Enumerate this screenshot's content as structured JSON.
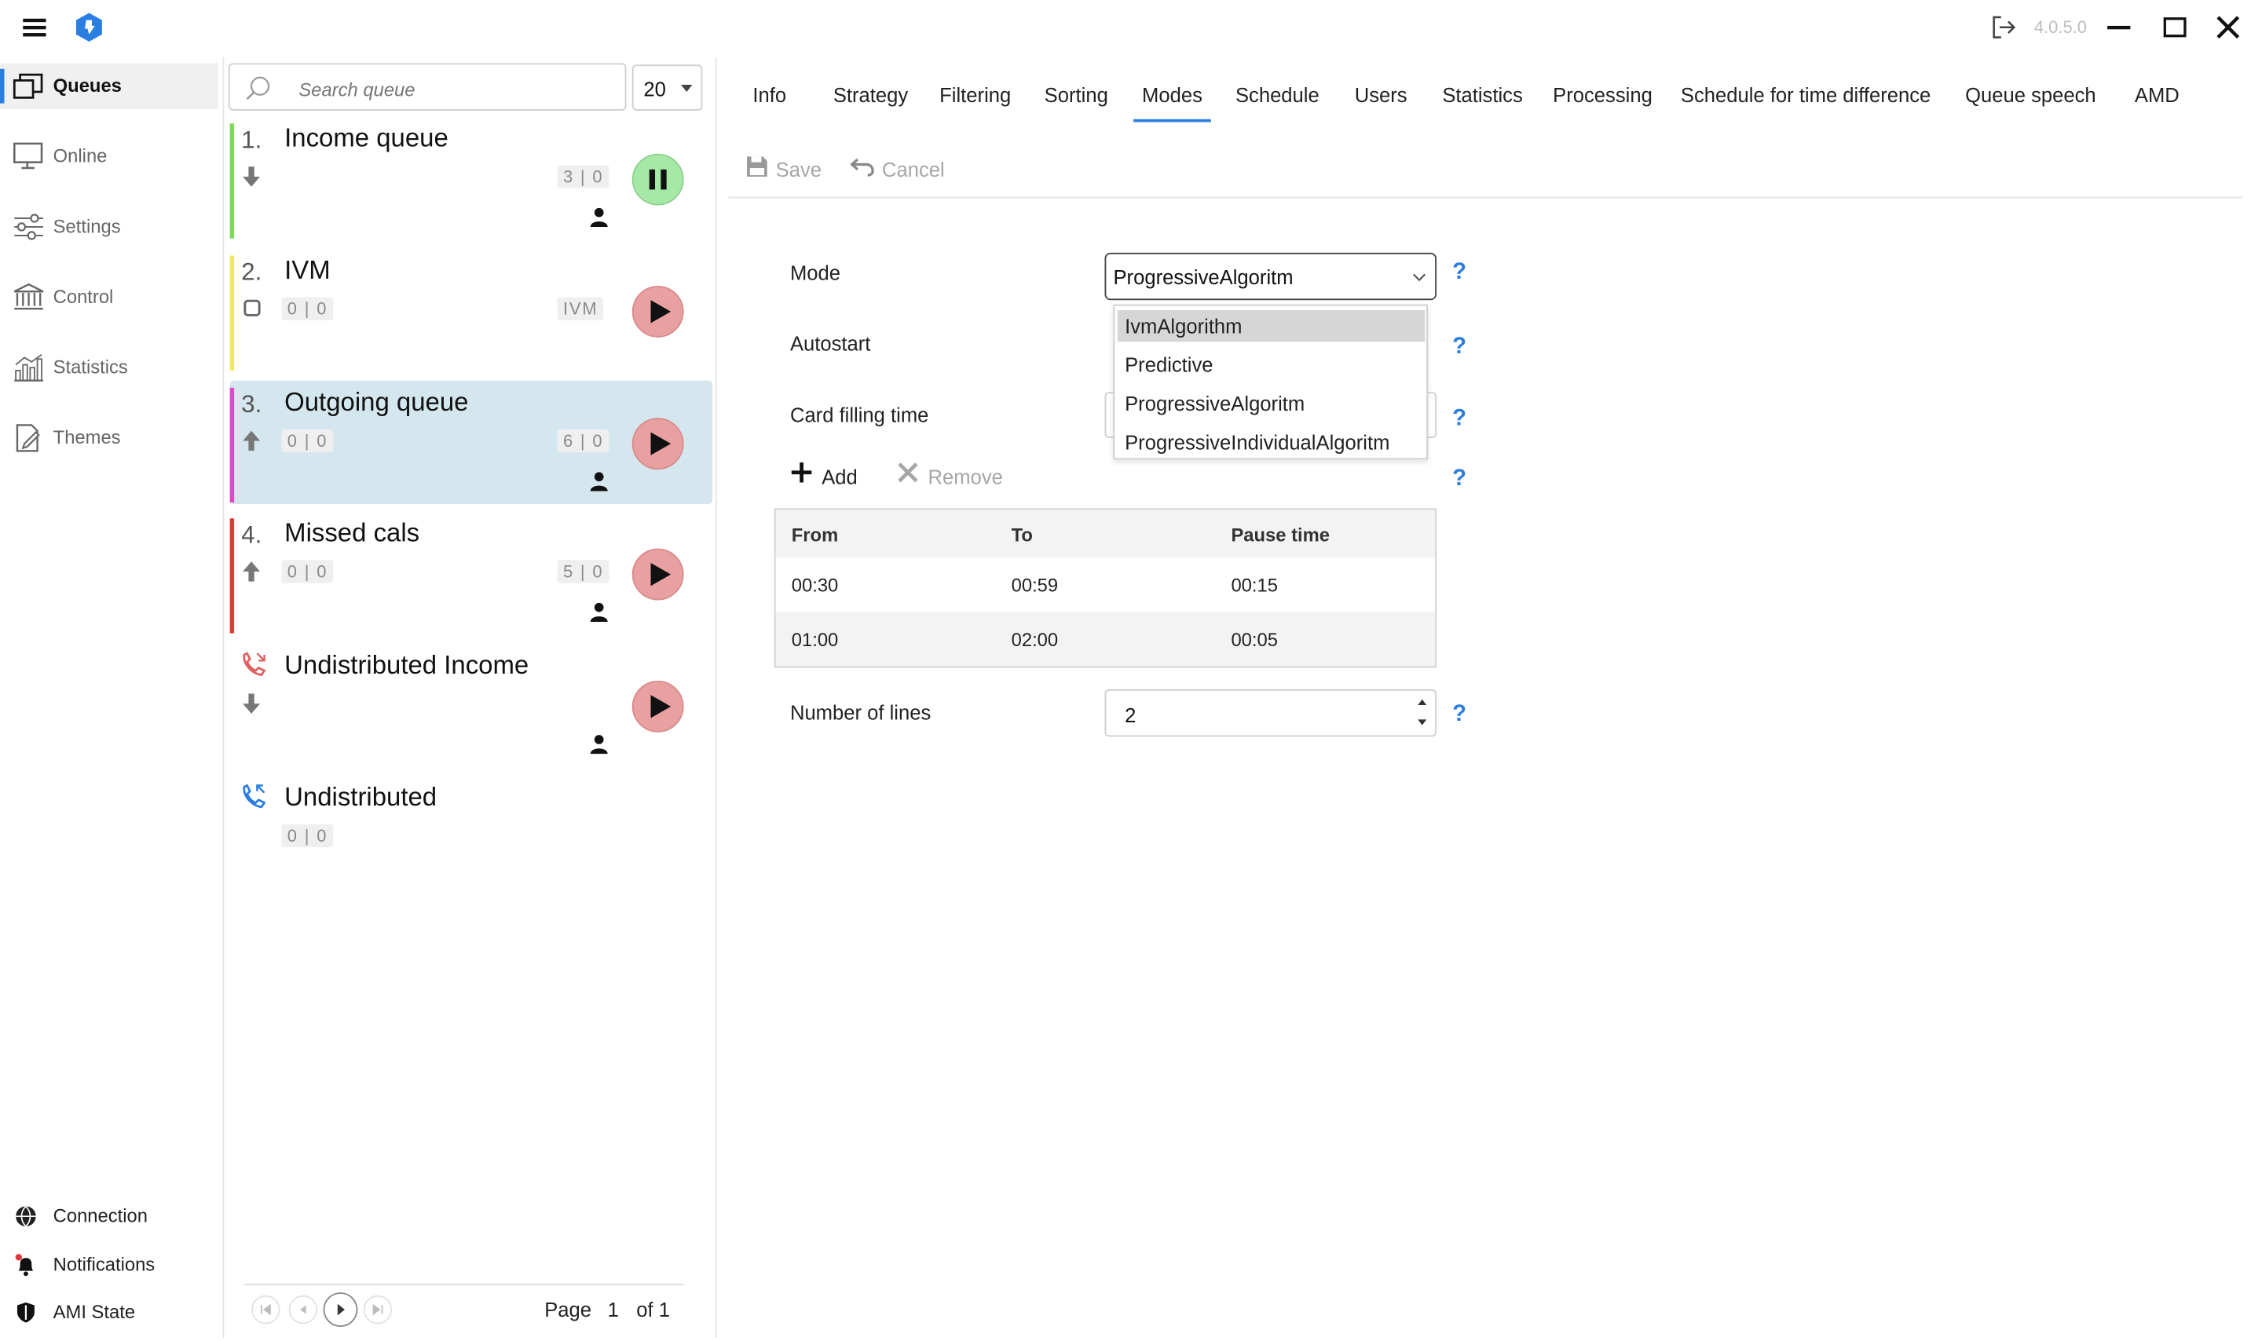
{
  "app": {
    "version": "4.0.5.0"
  },
  "nav": {
    "items": [
      {
        "label": "Queues",
        "active": true
      },
      {
        "label": "Online"
      },
      {
        "label": "Settings"
      },
      {
        "label": "Control"
      },
      {
        "label": "Statistics"
      },
      {
        "label": "Themes"
      }
    ],
    "bottom": [
      {
        "label": "Connection"
      },
      {
        "label": "Notifications"
      },
      {
        "label": "AMI State"
      }
    ]
  },
  "queue_panel": {
    "search_placeholder": "Search queue",
    "page_size": "20",
    "queues": [
      {
        "num": "1.",
        "title": "Income queue",
        "left_count": "",
        "right_count": "3 | 0",
        "bar_color": "#7ed957",
        "state": "pause"
      },
      {
        "num": "2.",
        "title": "IVM",
        "left_count": "0 | 0",
        "right_count": "IVM",
        "bar_color": "#f0ea5a",
        "state": "play"
      },
      {
        "num": "3.",
        "title": "Outgoing queue",
        "left_count": "0 | 0",
        "right_count": "6 | 0",
        "bar_color": "#e048c8",
        "state": "play",
        "selected": true
      },
      {
        "num": "4.",
        "title": "Missed cals",
        "left_count": "0 | 0",
        "right_count": "5 | 0",
        "bar_color": "#e03a3a",
        "state": "play"
      },
      {
        "num": "",
        "title": "Undistributed Income",
        "left_count": "",
        "right_count": "",
        "state": "play"
      },
      {
        "num": "",
        "title": "Undistributed",
        "left_count": "0 | 0",
        "right_count": ""
      }
    ],
    "pager": {
      "page_label": "Page",
      "page": "1",
      "of_label": "of 1"
    }
  },
  "tabs": [
    "Info",
    "Strategy",
    "Filtering",
    "Sorting",
    "Modes",
    "Schedule",
    "Users",
    "Statistics",
    "Processing",
    "Schedule for time difference",
    "Queue speech",
    "AMD"
  ],
  "active_tab": "Modes",
  "toolbar": {
    "save": "Save",
    "cancel": "Cancel"
  },
  "form": {
    "mode_label": "Mode",
    "mode_value": "ProgressiveAlgoritm",
    "autostart_label": "Autostart",
    "card_filling_label": "Card filling time",
    "add_label": "Add",
    "remove_label": "Remove",
    "help": "?",
    "lines_label": "Number of lines",
    "lines_value": "2"
  },
  "dropdown_options": [
    "IvmAlgorithm",
    "Predictive",
    "ProgressiveAlgoritm",
    "ProgressiveIndividualAlgoritm"
  ],
  "pause_table": {
    "headers": [
      "From",
      "To",
      "Pause time"
    ],
    "rows": [
      [
        "00:30",
        "00:59",
        "00:15"
      ],
      [
        "01:00",
        "02:00",
        "00:05"
      ]
    ]
  },
  "colors": {
    "accent": "#2a7de1",
    "play_button": "#e8a0a0",
    "pause_button": "#a6e8a6",
    "selected_row": "#d4e6ee"
  }
}
